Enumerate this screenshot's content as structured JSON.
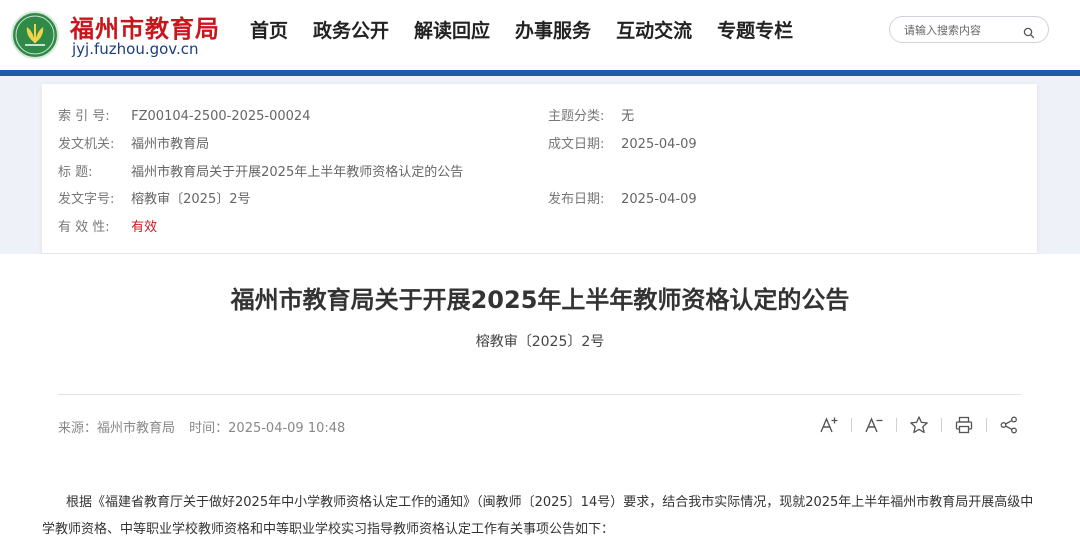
{
  "site": {
    "name": "福州市教育局",
    "domain": "jyj.fuzhou.gov.cn",
    "brand_color": "#c8161d",
    "accent_color": "#1f5aa6"
  },
  "nav": {
    "items": [
      {
        "label": "首页"
      },
      {
        "label": "政务公开"
      },
      {
        "label": "解读回应"
      },
      {
        "label": "办事服务"
      },
      {
        "label": "互动交流"
      },
      {
        "label": "专题专栏"
      }
    ]
  },
  "search": {
    "placeholder": "请输入搜索内容",
    "icon": "search-icon"
  },
  "meta": {
    "index_label": "索 引 号:",
    "index_value": "FZ00104-2500-2025-00024",
    "topic_label": "主题分类:",
    "topic_value": "无",
    "issuer_label": "发文机关:",
    "issuer_value": "福州市教育局",
    "created_label": "成文日期:",
    "created_value": "2025-04-09",
    "title_label": "标 题:",
    "title_value": "福州市教育局关于开展2025年上半年教师资格认定的公告",
    "docno_label": "发文字号:",
    "docno_value": "榕教审〔2025〕2号",
    "published_label": "发布日期:",
    "published_value": "2025-04-09",
    "validity_label": "有 效 性:",
    "validity_value": "有效",
    "validity_color": "#d0161d"
  },
  "article": {
    "title": "福州市教育局关于开展2025年上半年教师资格认定的公告",
    "doc_number": "榕教审〔2025〕2号",
    "source": "来源：福州市教育局",
    "time": "时间：2025-04-09 10:48",
    "tools": [
      "font-increase-icon",
      "font-decrease-icon",
      "star-icon",
      "print-icon",
      "share-icon"
    ],
    "body": "根据《福建省教育厅关于做好2025年中小学教师资格认定工作的通知》（闽教师〔2025〕14号）要求，结合我市实际情况，现就2025年上半年福州市教育局开展高级中学教师资格、中等职业学校教师资格和中等职业学校实习指导教师资格认定工作有关事项公告如下："
  }
}
